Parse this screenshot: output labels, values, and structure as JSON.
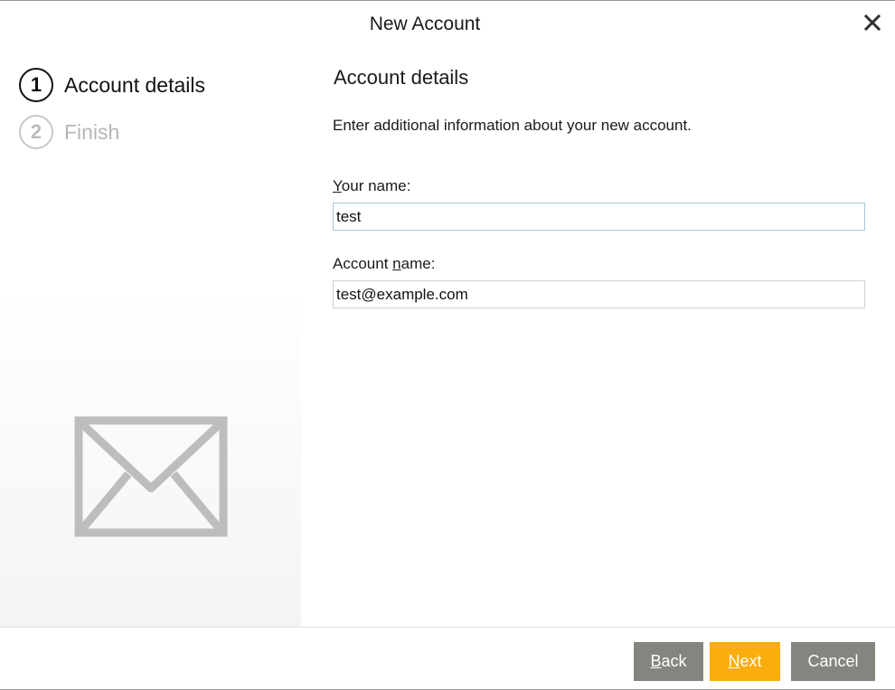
{
  "dialog": {
    "title": "New Account"
  },
  "steps": [
    {
      "number": "1",
      "label": "Account details",
      "state": "active"
    },
    {
      "number": "2",
      "label": "Finish",
      "state": "inactive"
    }
  ],
  "content": {
    "heading": "Account details",
    "description": "Enter additional information about your new account.",
    "your_name": {
      "label_accel": "Y",
      "label_rest": "our name:",
      "value": "test"
    },
    "account_name": {
      "label_pre": "Account ",
      "label_accel": "n",
      "label_post": "ame:",
      "value": "test@example.com"
    }
  },
  "buttons": {
    "back": {
      "accel": "B",
      "rest": "ack"
    },
    "next": {
      "accel": "N",
      "rest": "ext"
    },
    "cancel": {
      "label": "Cancel"
    }
  },
  "icons": {
    "close": "close-icon",
    "envelope": "envelope-icon"
  },
  "colors": {
    "accent": "#fbac0e",
    "button_gray": "#85857f",
    "step_active": "#111111",
    "step_inactive": "#bdbdbd",
    "envelope": "#bdbdbd",
    "input_focus_border": "#a8c6d8"
  }
}
